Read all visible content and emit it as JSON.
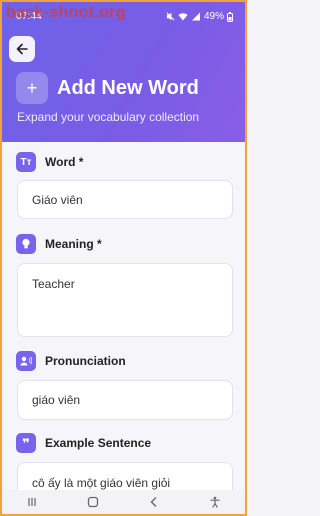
{
  "status": {
    "time": "07:44",
    "battery": "49%"
  },
  "watermark": "back-shoot.org",
  "header": {
    "title": "Add New Word",
    "subtitle": "Expand your vocabulary collection",
    "title_icon": "+"
  },
  "form": {
    "word": {
      "label": "Word *",
      "value": "Giáo viên",
      "icon": "text-icon"
    },
    "meaning": {
      "label": "Meaning *",
      "value": "Teacher",
      "icon": "lightbulb-icon"
    },
    "pronunciation": {
      "label": "Pronunciation",
      "value": "giáo viên",
      "icon": "speaker-icon"
    },
    "example": {
      "label": "Example Sentence",
      "value": "cô ấy là một giáo viên giỏi",
      "icon": "quote-icon"
    }
  },
  "colors": {
    "accent": "#7a63ec",
    "header_gradient_start": "#6d63e8",
    "header_gradient_end": "#8a5ee6"
  }
}
